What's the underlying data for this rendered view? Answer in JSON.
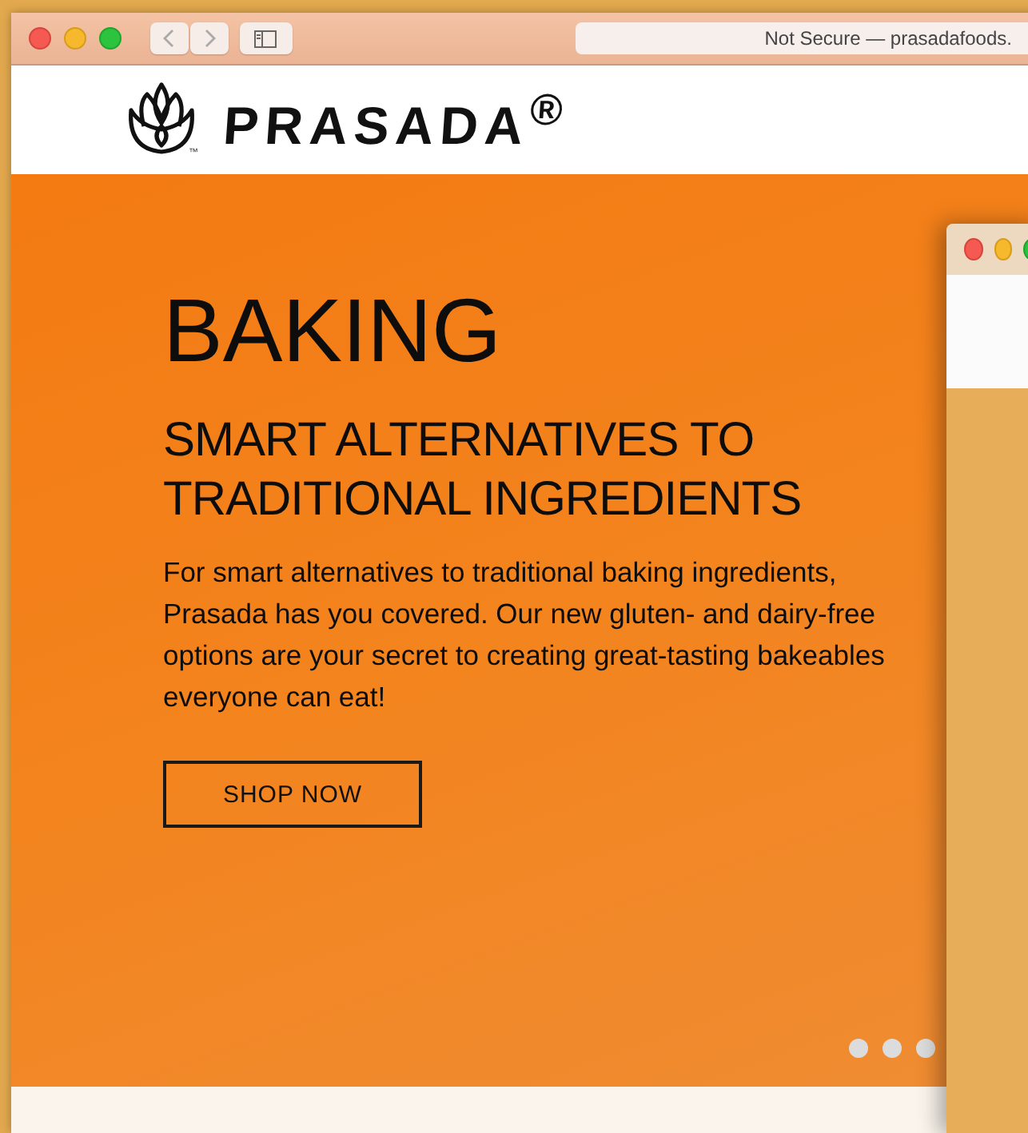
{
  "browser": {
    "address": "Not Secure — prasadafoods."
  },
  "header": {
    "logo": "PRASADA$^{®}$",
    "trademark": "™"
  },
  "hero": {
    "title": "BAKING",
    "subtitle": "SMART ALTERNATIVES TO TRADITIONAL INGREDIENTS",
    "body": "For smart alternatives to traditional baking ingredients, Prasada has you covered. Our new gluten- and dairy-free options are your secret to creating great-tasting bakeables everyone can eat!",
    "button": "SHOP NOW",
    "dots": [
      {
        "selected": false
      },
      {
        "selected": false
      },
      {
        "selected": false
      }
    ]
  }
}
